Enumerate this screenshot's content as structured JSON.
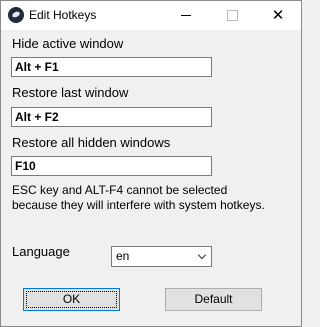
{
  "window": {
    "title": "Edit Hotkeys",
    "close_glyph": "✕"
  },
  "hotkeys": [
    {
      "label": "Hide active window",
      "value": "Alt + F1"
    },
    {
      "label": "Restore last window",
      "value": "Alt + F2"
    },
    {
      "label": "Restore all hidden windows",
      "value": "F10"
    }
  ],
  "note": {
    "line1": "ESC key and ALT-F4 cannot be selected",
    "line2": "because they will interfere with system hotkeys."
  },
  "language": {
    "label": "Language",
    "selected": "en"
  },
  "buttons": {
    "ok": "OK",
    "default": "Default"
  },
  "icons": {
    "app": "app-icon",
    "minimize": "minimize-icon",
    "maximize": "maximize-icon",
    "close": "close-icon",
    "dropdown": "chevron-down-icon"
  }
}
